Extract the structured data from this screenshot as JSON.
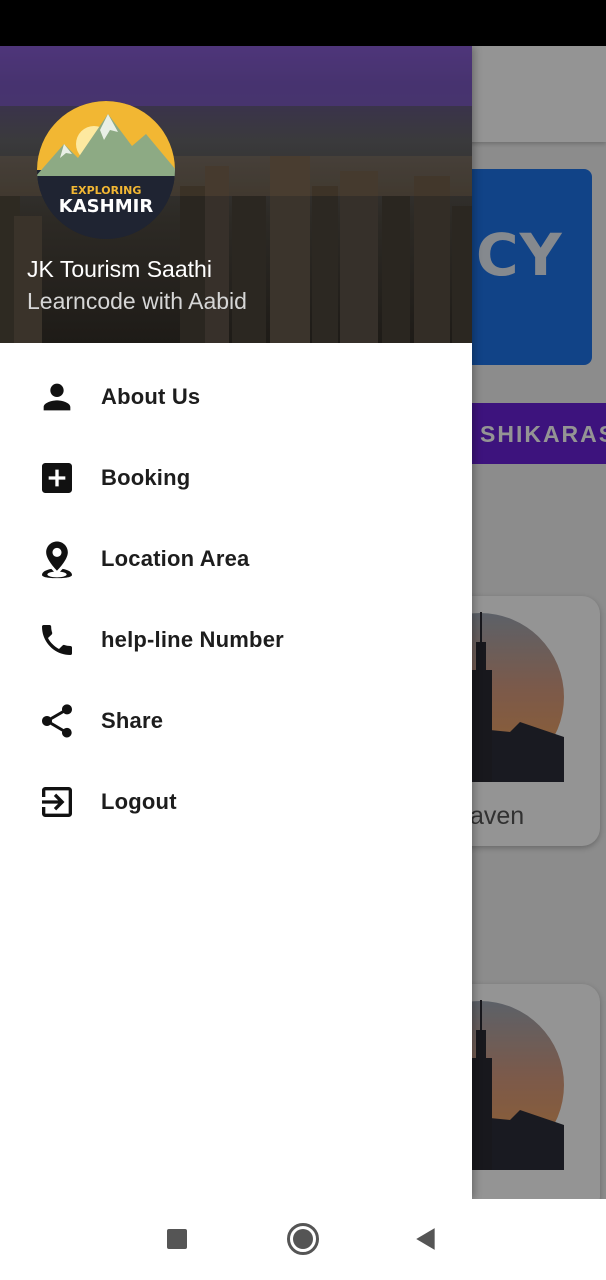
{
  "background_app": {
    "banner_text": "CY",
    "tab_label": "SHIKARAS",
    "card_1_caption": "aven",
    "card_2_caption": "",
    "accent_color": "#6a22d8",
    "banner_color": "#1e74e8"
  },
  "drawer": {
    "header": {
      "logo_line_1": "EXPLORING",
      "logo_line_2": "KASHMIR",
      "title": "JK Tourism Saathi",
      "subtitle": "Learncode with Aabid"
    },
    "items": [
      {
        "label": "About Us",
        "icon": "person-icon"
      },
      {
        "label": "Booking",
        "icon": "add-box-icon"
      },
      {
        "label": "Location Area",
        "icon": "location-pin-icon"
      },
      {
        "label": "help-line Number",
        "icon": "phone-icon"
      },
      {
        "label": "Share",
        "icon": "share-icon"
      },
      {
        "label": "Logout",
        "icon": "logout-icon"
      }
    ]
  },
  "nav_bar": {
    "buttons": [
      "recents-button",
      "home-button",
      "back-button"
    ]
  }
}
